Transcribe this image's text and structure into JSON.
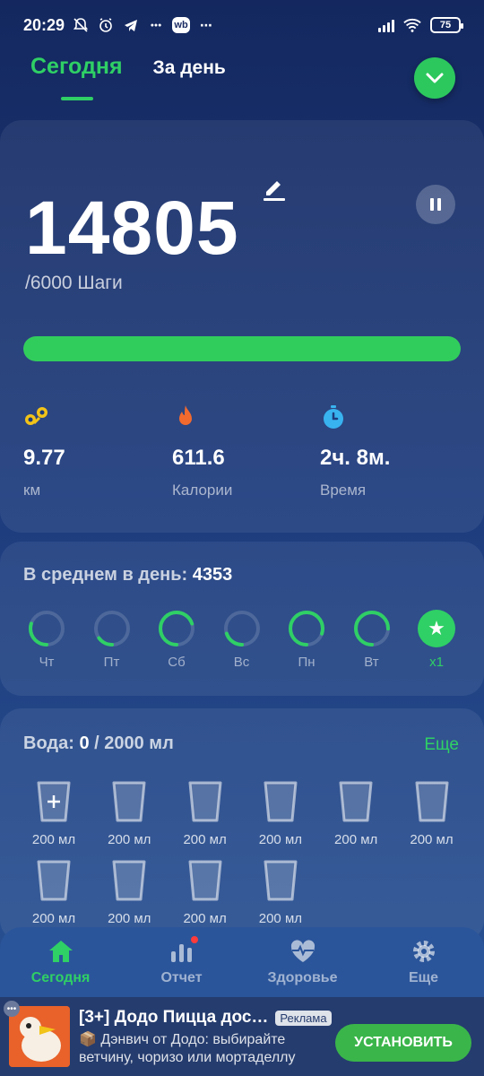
{
  "status_bar": {
    "time": "20:29",
    "icons": [
      "mute-bell-icon",
      "alarm-icon",
      "telegram-icon",
      "detmir-icon",
      "wb-icon",
      "more-dots-icon"
    ],
    "wb_label": "wb",
    "battery": "75"
  },
  "tabs": [
    {
      "label": "Сегодня",
      "active": true
    },
    {
      "label": "За день",
      "active": false
    }
  ],
  "steps": {
    "count": "14805",
    "goal_text": "/6000 Шаги",
    "progress": 1.0
  },
  "stats": [
    {
      "icon": "distance-icon",
      "value": "9.77",
      "label": "км"
    },
    {
      "icon": "fire-icon",
      "value": "611.6",
      "label": "Калории"
    },
    {
      "icon": "stopwatch-icon",
      "value": "2ч. 8м.",
      "label": "Время"
    }
  ],
  "average": {
    "label": "В среднем в день:",
    "value": "4353",
    "days": [
      {
        "label": "Чт",
        "fraction": 0.3
      },
      {
        "label": "Пт",
        "fraction": 0.15
      },
      {
        "label": "Сб",
        "fraction": 0.7
      },
      {
        "label": "Вс",
        "fraction": 0.2
      },
      {
        "label": "Пн",
        "fraction": 0.8
      },
      {
        "label": "Вт",
        "fraction": 0.75
      },
      {
        "label": "x1",
        "star": true
      }
    ]
  },
  "water": {
    "label": "Вода:",
    "value": "0",
    "goal": "/ 2000 мл",
    "more": "Еще",
    "glasses": [
      "200 мл",
      "200 мл",
      "200 мл",
      "200 мл",
      "200 мл",
      "200 мл",
      "200 мл",
      "200 мл",
      "200 мл",
      "200 мл"
    ]
  },
  "bottom_nav": [
    {
      "label": "Сегодня",
      "icon": "home-icon",
      "active": true
    },
    {
      "label": "Отчет",
      "icon": "bar-chart-icon",
      "active": false
    },
    {
      "label": "Здоровье",
      "icon": "heartbeat-icon",
      "active": false
    },
    {
      "label": "Еще",
      "icon": "gear-icon",
      "active": false
    }
  ],
  "ad": {
    "title": "[3+] Додо Пицца дос…",
    "badge": "Реклама",
    "description": "📦 Дэнвич от Додо: выбирайте ветчину, чоризо или мортаделлу",
    "button": "УСТАНОВИТЬ"
  },
  "colors": {
    "accent": "#2fd065",
    "background": "#1d3b7c"
  }
}
